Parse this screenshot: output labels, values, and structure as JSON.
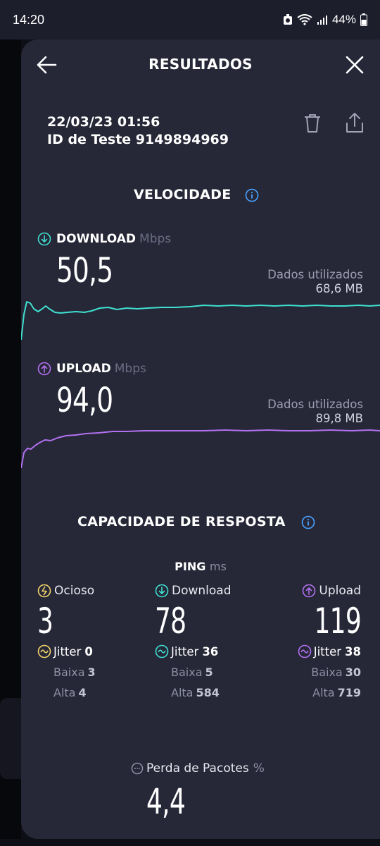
{
  "status": {
    "time": "14:20",
    "battery": "44%"
  },
  "header": {
    "title": "RESULTADOS"
  },
  "test": {
    "datetime": "22/03/23 01:56",
    "id": "ID de Teste 9149894969"
  },
  "speed": {
    "title": "VELOCIDADE",
    "download": {
      "label": "DOWNLOAD",
      "unit": "Mbps",
      "value": "50,5",
      "data_label": "Dados utilizados",
      "data_value": "68,6 MB",
      "color": "#3fe0d0"
    },
    "upload": {
      "label": "UPLOAD",
      "unit": "Mbps",
      "value": "94,0",
      "data_label": "Dados utilizados",
      "data_value": "89,8 MB",
      "color": "#b271f0"
    }
  },
  "responsiveness": {
    "title": "CAPACIDADE DE RESPOSTA",
    "ping_label": "PING",
    "ping_unit": "ms",
    "columns": [
      {
        "label": "Ocioso",
        "value": "3",
        "jitter_label": "Jitter",
        "jitter": "0",
        "low_label": "Baixa",
        "low": "3",
        "high_label": "Alta",
        "high": "4",
        "color": "#f3d46b"
      },
      {
        "label": "Download",
        "value": "78",
        "jitter_label": "Jitter",
        "jitter": "36",
        "low_label": "Baixa",
        "low": "5",
        "high_label": "Alta",
        "high": "584",
        "color": "#3fe0d0"
      },
      {
        "label": "Upload",
        "value": "119",
        "jitter_label": "Jitter",
        "jitter": "38",
        "low_label": "Baixa",
        "low": "30",
        "high_label": "Alta",
        "high": "719",
        "color": "#b271f0"
      }
    ]
  },
  "packet_loss": {
    "label": "Perda de Pacotes",
    "unit": "%",
    "value": "4,4"
  },
  "icons": {
    "back": "arrow-left-icon",
    "close": "close-icon",
    "trash": "trash-icon",
    "share": "share-icon",
    "info": "info-icon",
    "download": "download-arrow-icon",
    "upload": "upload-arrow-icon",
    "idle": "idle-icon",
    "jitter": "jitter-wave-icon",
    "loss": "packet-loss-icon"
  },
  "colors": {
    "accent_info": "#4aa3ff",
    "sheet_bg": "#262737"
  }
}
